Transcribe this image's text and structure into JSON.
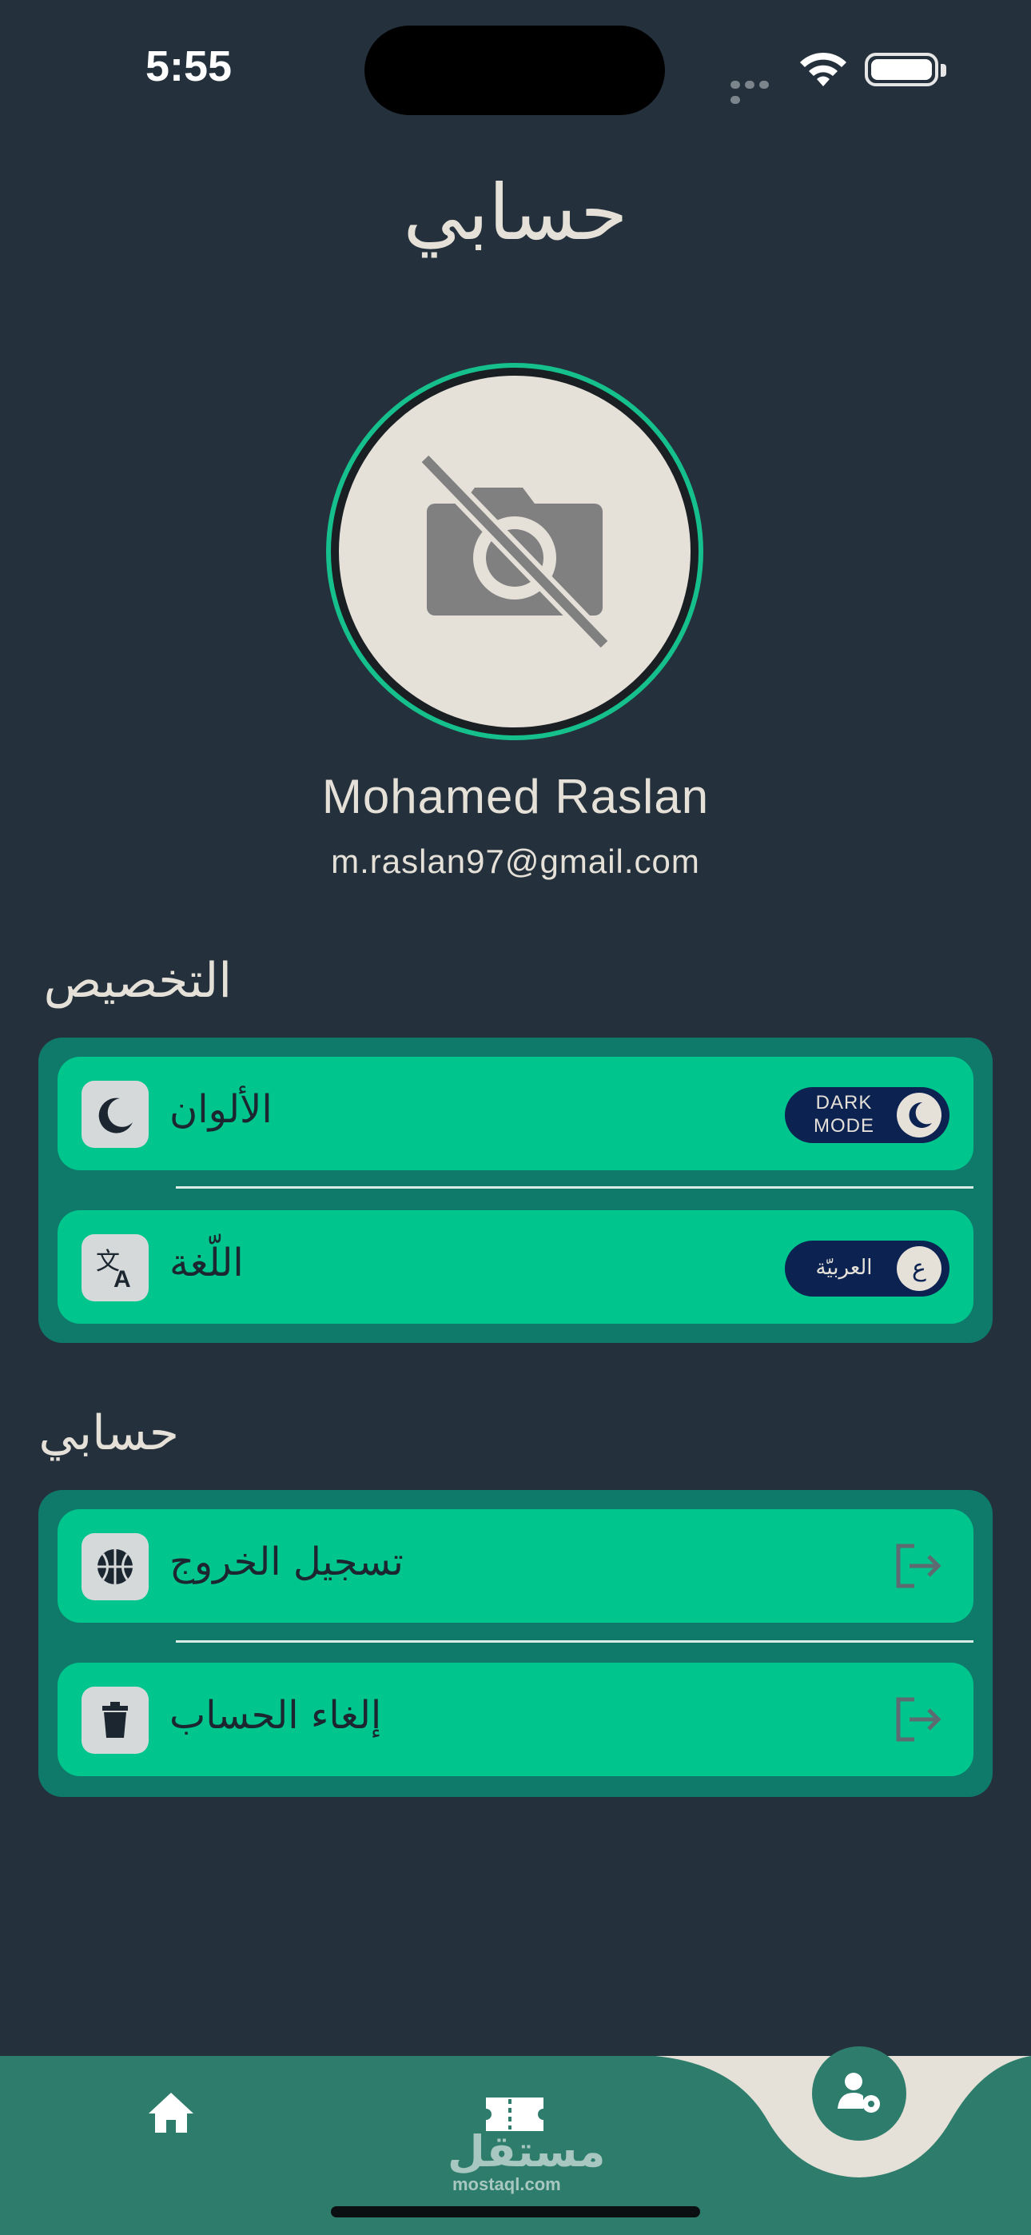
{
  "status_bar": {
    "time": "5:55"
  },
  "header": {
    "title": "حسابي"
  },
  "profile": {
    "name": "Mohamed Raslan",
    "email": "m.raslan97@gmail.com"
  },
  "sections": {
    "customization": {
      "title": "التخصيص",
      "colors": {
        "label": "الألوان",
        "icon": "moon-icon",
        "toggle_text": "DARK MODE"
      },
      "language": {
        "label": "اللّغة",
        "icon": "translate-icon",
        "toggle_text": "العربيّة",
        "toggle_knob": "ع"
      }
    },
    "account": {
      "title": "حسابي",
      "logout": {
        "label": "تسجيل الخروج",
        "icon": "basketball-icon"
      },
      "delete": {
        "label": "إلغاء الحساب",
        "icon": "trash-icon"
      }
    }
  },
  "bottom_nav": {
    "items": [
      "home-icon",
      "ticket-icon",
      "user-settings-icon"
    ],
    "watermark_ar": "مستقل",
    "watermark_en": "mostaql.com"
  },
  "colors": {
    "background": "#24313c",
    "accent": "#00c58d",
    "card": "#0f7a6a",
    "toggle": "#0c2352",
    "navbar": "#2e7d6c"
  }
}
